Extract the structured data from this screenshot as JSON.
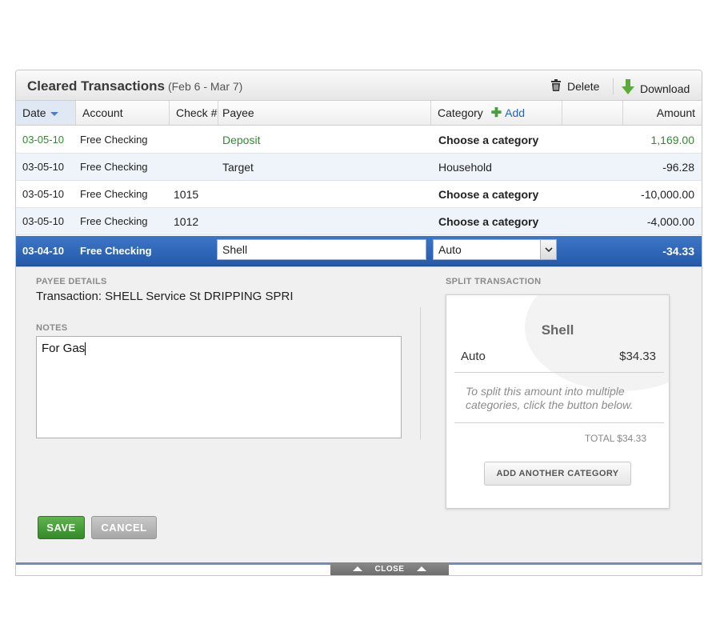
{
  "header": {
    "title": "Cleared Transactions",
    "date_range": "(Feb 6 - Mar 7)",
    "delete_label": "Delete",
    "download_label": "Download"
  },
  "columns": {
    "date": "Date",
    "account": "Account",
    "check": "Check #",
    "payee": "Payee",
    "category": "Category",
    "add": "Add",
    "amount": "Amount"
  },
  "rows": [
    {
      "date": "03-05-10",
      "account": "Free Checking",
      "check": "",
      "payee": "Deposit",
      "category": "Choose a category",
      "amount": "1,169.00"
    },
    {
      "date": "03-05-10",
      "account": "Free Checking",
      "check": "",
      "payee": "Target",
      "category": "Household",
      "amount": "-96.28"
    },
    {
      "date": "03-05-10",
      "account": "Free Checking",
      "check": "1015",
      "payee": "",
      "category": "Choose a category",
      "amount": "-10,000.00"
    },
    {
      "date": "03-05-10",
      "account": "Free Checking",
      "check": "1012",
      "payee": "",
      "category": "Choose a category",
      "amount": "-4,000.00"
    }
  ],
  "selected_row": {
    "date": "03-04-10",
    "account": "Free Checking",
    "payee_value": "Shell",
    "category_value": "Auto",
    "amount": "-34.33"
  },
  "detail": {
    "payee_details_label": "PAYEE DETAILS",
    "transaction_text": "Transaction: SHELL Service St DRIPPING SPRI",
    "notes_label": "NOTES",
    "notes_value": "For Gas",
    "split_label": "SPLIT TRANSACTION",
    "split_title": "Shell",
    "split_category": "Auto",
    "split_amount": "$34.33",
    "split_help": "To split this amount into multiple categories, click the button below.",
    "split_total": "TOTAL $34.33",
    "add_category_label": "ADD ANOTHER CATEGORY",
    "save_label": "SAVE",
    "cancel_label": "CANCEL",
    "close_label": "CLOSE"
  },
  "colors": {
    "selected_row": "#2f67b7",
    "alt_row": "#eef4fa",
    "deposit_green": "#2e8b2e",
    "save_green": "#45a03a",
    "link_blue": "#2467b6"
  }
}
